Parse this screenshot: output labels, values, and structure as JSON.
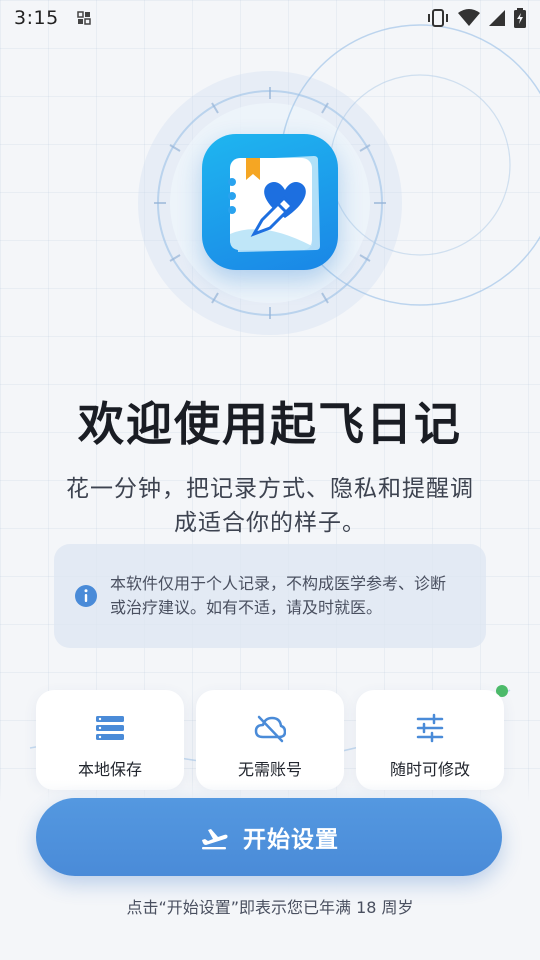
{
  "status_bar": {
    "time": "3:15"
  },
  "colors": {
    "accent": "#4a8bd8",
    "logo_gradient_start": "#1fb6f0",
    "logo_gradient_end": "#1a86e6",
    "status_dot": "#4cbb6a"
  },
  "welcome": {
    "title": "欢迎使用起飞日记",
    "subtitle": "花一分钟，把记录方式、隐私和提醒调成适合你的样子。"
  },
  "notice": {
    "icon": "info-icon",
    "text": "本软件仅用于个人记录，不构成医学参考、诊断或治疗建议。如有不适，请及时就医。"
  },
  "features": [
    {
      "icon": "storage-icon",
      "label": "本地保存"
    },
    {
      "icon": "cloud-off-icon",
      "label": "无需账号"
    },
    {
      "icon": "sliders-icon",
      "label": "随时可修改"
    }
  ],
  "start_button": {
    "icon": "airplane-takeoff-icon",
    "label": "开始设置"
  },
  "footnote": "点击“开始设置”即表示您已年满 18 周岁"
}
